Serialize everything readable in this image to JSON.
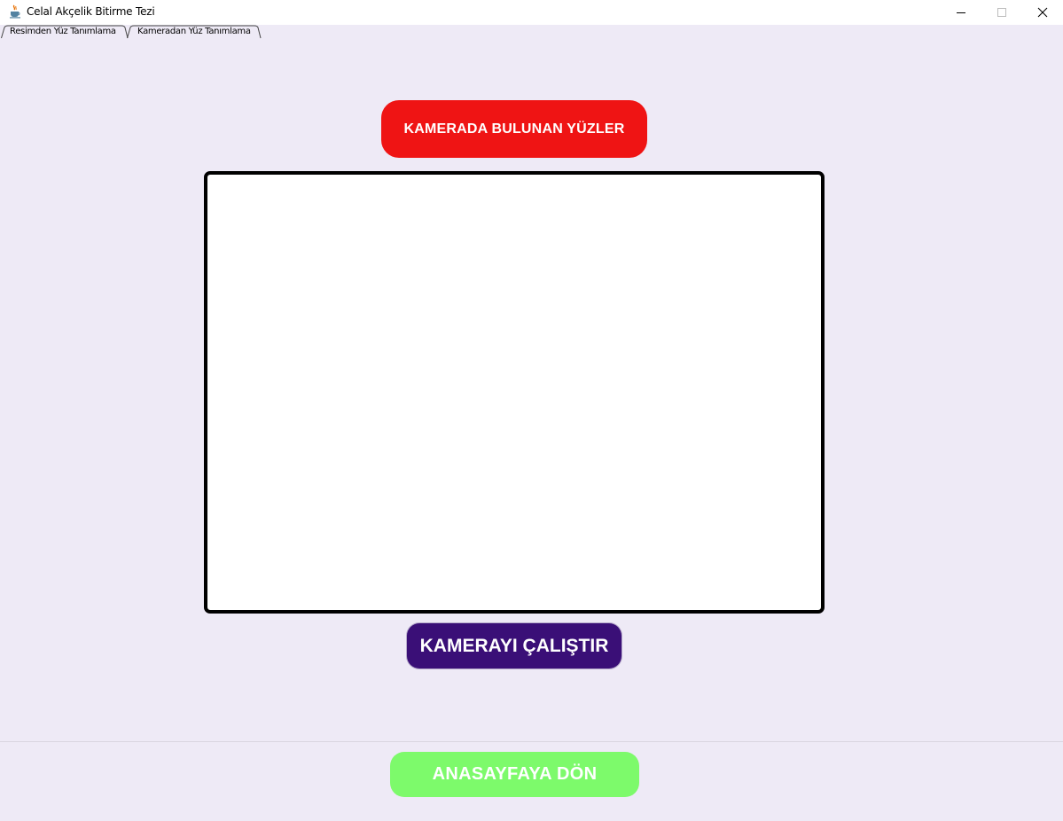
{
  "window": {
    "title": "Celal Akçelik Bitirme Tezi",
    "icon": "java-cup-icon"
  },
  "tabs": [
    {
      "label": "Resimden Yüz Tanımlama",
      "active": false
    },
    {
      "label": "Kameradan Yüz Tanımlama",
      "active": true
    }
  ],
  "header": {
    "label": "KAMERADA BULUNAN YÜZLER",
    "color": "#ef1414"
  },
  "camera_view": {
    "background": "#ffffff",
    "border_color": "#000000"
  },
  "actions": {
    "run_camera_label": "KAMERAYI ÇALIŞTIR",
    "run_camera_color": "#3a0f77",
    "home_label": "ANASAYFAYA DÖN",
    "home_color": "#7dfa6b"
  },
  "colors": {
    "background": "#eeeaf6"
  }
}
